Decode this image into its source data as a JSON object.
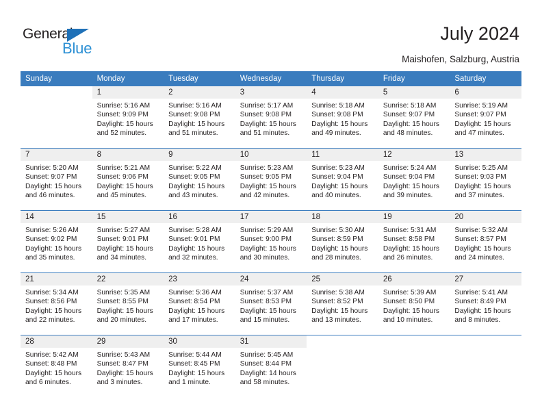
{
  "brand": {
    "name_part1": "General",
    "name_part2": "Blue",
    "accent_color": "#2b8fd4",
    "triangle_color": "#1f71b8"
  },
  "header": {
    "title": "July 2024",
    "location": "Maishofen, Salzburg, Austria"
  },
  "theme": {
    "header_row_bg": "#3a7cbe",
    "daynum_bg": "#efefef",
    "text_color": "#231f20"
  },
  "weekdays": [
    "Sunday",
    "Monday",
    "Tuesday",
    "Wednesday",
    "Thursday",
    "Friday",
    "Saturday"
  ],
  "weeks": [
    [
      {
        "day": "",
        "lines": [
          "",
          "",
          "",
          ""
        ]
      },
      {
        "day": "1",
        "lines": [
          "Sunrise: 5:16 AM",
          "Sunset: 9:09 PM",
          "Daylight: 15 hours",
          "and 52 minutes."
        ]
      },
      {
        "day": "2",
        "lines": [
          "Sunrise: 5:16 AM",
          "Sunset: 9:08 PM",
          "Daylight: 15 hours",
          "and 51 minutes."
        ]
      },
      {
        "day": "3",
        "lines": [
          "Sunrise: 5:17 AM",
          "Sunset: 9:08 PM",
          "Daylight: 15 hours",
          "and 51 minutes."
        ]
      },
      {
        "day": "4",
        "lines": [
          "Sunrise: 5:18 AM",
          "Sunset: 9:08 PM",
          "Daylight: 15 hours",
          "and 49 minutes."
        ]
      },
      {
        "day": "5",
        "lines": [
          "Sunrise: 5:18 AM",
          "Sunset: 9:07 PM",
          "Daylight: 15 hours",
          "and 48 minutes."
        ]
      },
      {
        "day": "6",
        "lines": [
          "Sunrise: 5:19 AM",
          "Sunset: 9:07 PM",
          "Daylight: 15 hours",
          "and 47 minutes."
        ]
      }
    ],
    [
      {
        "day": "7",
        "lines": [
          "Sunrise: 5:20 AM",
          "Sunset: 9:07 PM",
          "Daylight: 15 hours",
          "and 46 minutes."
        ]
      },
      {
        "day": "8",
        "lines": [
          "Sunrise: 5:21 AM",
          "Sunset: 9:06 PM",
          "Daylight: 15 hours",
          "and 45 minutes."
        ]
      },
      {
        "day": "9",
        "lines": [
          "Sunrise: 5:22 AM",
          "Sunset: 9:05 PM",
          "Daylight: 15 hours",
          "and 43 minutes."
        ]
      },
      {
        "day": "10",
        "lines": [
          "Sunrise: 5:23 AM",
          "Sunset: 9:05 PM",
          "Daylight: 15 hours",
          "and 42 minutes."
        ]
      },
      {
        "day": "11",
        "lines": [
          "Sunrise: 5:23 AM",
          "Sunset: 9:04 PM",
          "Daylight: 15 hours",
          "and 40 minutes."
        ]
      },
      {
        "day": "12",
        "lines": [
          "Sunrise: 5:24 AM",
          "Sunset: 9:04 PM",
          "Daylight: 15 hours",
          "and 39 minutes."
        ]
      },
      {
        "day": "13",
        "lines": [
          "Sunrise: 5:25 AM",
          "Sunset: 9:03 PM",
          "Daylight: 15 hours",
          "and 37 minutes."
        ]
      }
    ],
    [
      {
        "day": "14",
        "lines": [
          "Sunrise: 5:26 AM",
          "Sunset: 9:02 PM",
          "Daylight: 15 hours",
          "and 35 minutes."
        ]
      },
      {
        "day": "15",
        "lines": [
          "Sunrise: 5:27 AM",
          "Sunset: 9:01 PM",
          "Daylight: 15 hours",
          "and 34 minutes."
        ]
      },
      {
        "day": "16",
        "lines": [
          "Sunrise: 5:28 AM",
          "Sunset: 9:01 PM",
          "Daylight: 15 hours",
          "and 32 minutes."
        ]
      },
      {
        "day": "17",
        "lines": [
          "Sunrise: 5:29 AM",
          "Sunset: 9:00 PM",
          "Daylight: 15 hours",
          "and 30 minutes."
        ]
      },
      {
        "day": "18",
        "lines": [
          "Sunrise: 5:30 AM",
          "Sunset: 8:59 PM",
          "Daylight: 15 hours",
          "and 28 minutes."
        ]
      },
      {
        "day": "19",
        "lines": [
          "Sunrise: 5:31 AM",
          "Sunset: 8:58 PM",
          "Daylight: 15 hours",
          "and 26 minutes."
        ]
      },
      {
        "day": "20",
        "lines": [
          "Sunrise: 5:32 AM",
          "Sunset: 8:57 PM",
          "Daylight: 15 hours",
          "and 24 minutes."
        ]
      }
    ],
    [
      {
        "day": "21",
        "lines": [
          "Sunrise: 5:34 AM",
          "Sunset: 8:56 PM",
          "Daylight: 15 hours",
          "and 22 minutes."
        ]
      },
      {
        "day": "22",
        "lines": [
          "Sunrise: 5:35 AM",
          "Sunset: 8:55 PM",
          "Daylight: 15 hours",
          "and 20 minutes."
        ]
      },
      {
        "day": "23",
        "lines": [
          "Sunrise: 5:36 AM",
          "Sunset: 8:54 PM",
          "Daylight: 15 hours",
          "and 17 minutes."
        ]
      },
      {
        "day": "24",
        "lines": [
          "Sunrise: 5:37 AM",
          "Sunset: 8:53 PM",
          "Daylight: 15 hours",
          "and 15 minutes."
        ]
      },
      {
        "day": "25",
        "lines": [
          "Sunrise: 5:38 AM",
          "Sunset: 8:52 PM",
          "Daylight: 15 hours",
          "and 13 minutes."
        ]
      },
      {
        "day": "26",
        "lines": [
          "Sunrise: 5:39 AM",
          "Sunset: 8:50 PM",
          "Daylight: 15 hours",
          "and 10 minutes."
        ]
      },
      {
        "day": "27",
        "lines": [
          "Sunrise: 5:41 AM",
          "Sunset: 8:49 PM",
          "Daylight: 15 hours",
          "and 8 minutes."
        ]
      }
    ],
    [
      {
        "day": "28",
        "lines": [
          "Sunrise: 5:42 AM",
          "Sunset: 8:48 PM",
          "Daylight: 15 hours",
          "and 6 minutes."
        ]
      },
      {
        "day": "29",
        "lines": [
          "Sunrise: 5:43 AM",
          "Sunset: 8:47 PM",
          "Daylight: 15 hours",
          "and 3 minutes."
        ]
      },
      {
        "day": "30",
        "lines": [
          "Sunrise: 5:44 AM",
          "Sunset: 8:45 PM",
          "Daylight: 15 hours",
          "and 1 minute."
        ]
      },
      {
        "day": "31",
        "lines": [
          "Sunrise: 5:45 AM",
          "Sunset: 8:44 PM",
          "Daylight: 14 hours",
          "and 58 minutes."
        ]
      },
      {
        "day": "",
        "lines": [
          "",
          "",
          "",
          ""
        ]
      },
      {
        "day": "",
        "lines": [
          "",
          "",
          "",
          ""
        ]
      },
      {
        "day": "",
        "lines": [
          "",
          "",
          "",
          ""
        ]
      }
    ]
  ]
}
